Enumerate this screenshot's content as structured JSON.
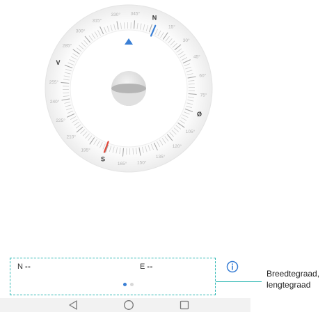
{
  "compass": {
    "north_label": "N",
    "west_label": "V",
    "east_label": "Ø",
    "south_label": "S",
    "degree_labels": [
      "15°",
      "30°",
      "45°",
      "60°",
      "75°",
      "105°",
      "120°",
      "135°",
      "150°",
      "165°",
      "195°",
      "210°",
      "225°",
      "240°",
      "255°",
      "285°",
      "300°",
      "315°",
      "330°",
      "345°"
    ],
    "colors": {
      "north_needle": "#3a7fd5",
      "south_needle": "#e04a3c",
      "pointer": "#3a7fd5"
    }
  },
  "coords": {
    "lat_dir": "N",
    "lat_value": "--",
    "lon_dir": "E",
    "lon_value": "--"
  },
  "callout": {
    "line1": "Breedtegraad,",
    "line2": "lengtegraad",
    "color": "#2bb7b3"
  },
  "navbar": {
    "icons": [
      "back-icon",
      "home-icon",
      "recents-icon"
    ]
  }
}
